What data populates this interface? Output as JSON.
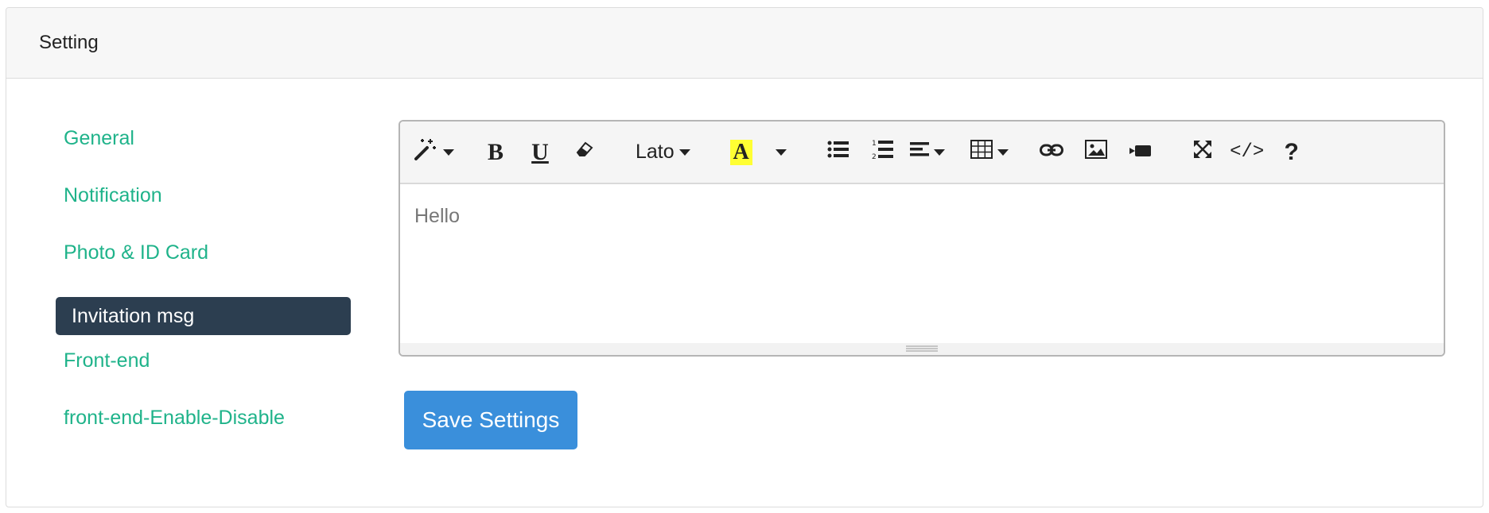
{
  "panel": {
    "title": "Setting"
  },
  "sidebar": {
    "items": [
      {
        "label": "General"
      },
      {
        "label": "Notification"
      },
      {
        "label": "Photo & ID Card"
      },
      {
        "label": "Invitation msg",
        "active": true
      },
      {
        "label": "Front-end"
      },
      {
        "label": "front-end-Enable-Disable"
      }
    ]
  },
  "editor": {
    "font_name": "Lato",
    "highlight_letter": "A",
    "bold_letter": "B",
    "underline_letter": "U",
    "code_label": "</>",
    "help_label": "?",
    "content": "Hello",
    "highlight_color": "#ffff33"
  },
  "actions": {
    "save_label": "Save Settings"
  },
  "colors": {
    "link": "#1fb38a",
    "active_bg": "#2c3e50",
    "primary": "#3a8fdb"
  }
}
